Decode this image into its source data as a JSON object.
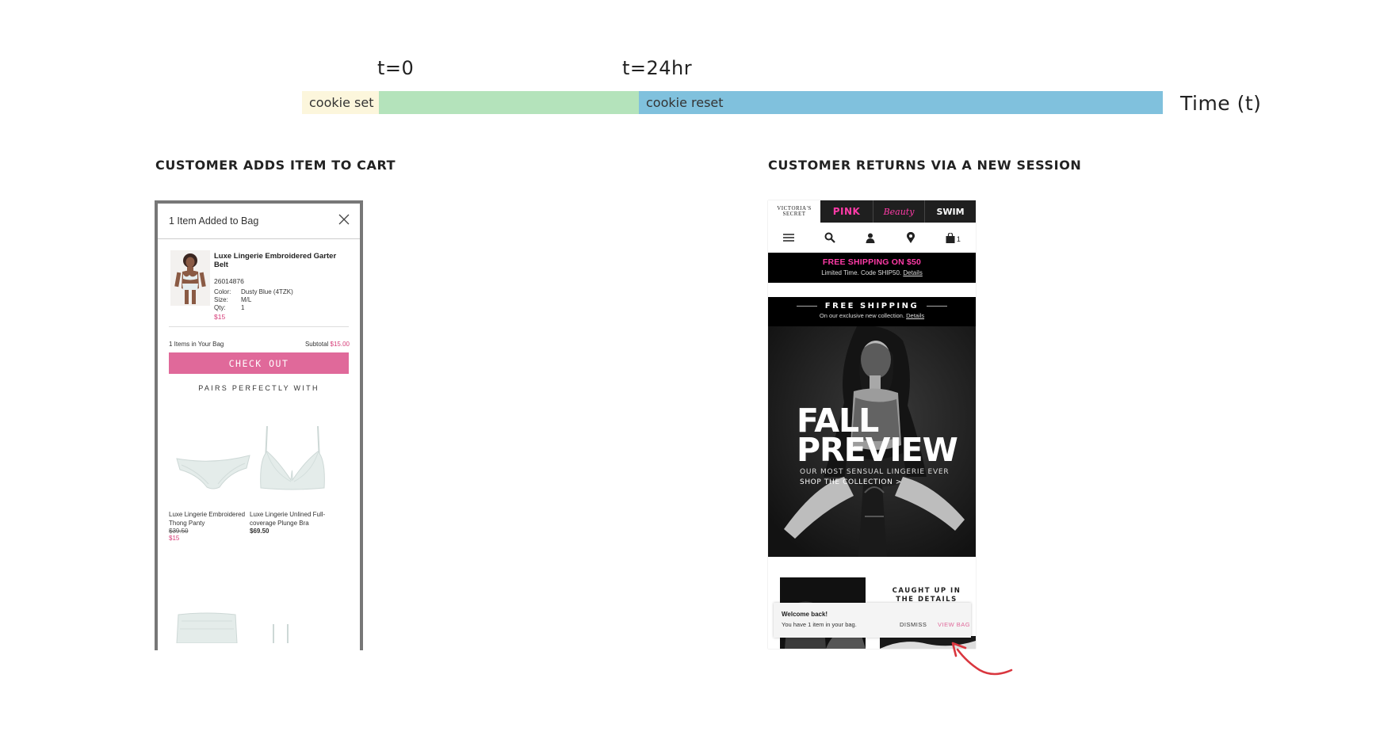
{
  "timeline": {
    "t0_label": "t=0",
    "t24_label": "t=24hr",
    "segment_set": "cookie set",
    "segment_reset": "cookie reset",
    "axis_title": "Time (t)",
    "colors": {
      "set": "#fcf6dc",
      "active": "#b4e3bb",
      "reset": "#80c1dd"
    }
  },
  "left_section": {
    "heading": "CUSTOMER ADDS ITEM TO CART",
    "modal_title": "1 Item Added to Bag",
    "item": {
      "name": "Luxe Lingerie Embroidered Garter Belt",
      "sku": "26014876",
      "color_key": "Color:",
      "color_value": "Dusty Blue (4TZK)",
      "size_key": "Size:",
      "size_value": "M/L",
      "qty_key": "Qty:",
      "qty_value": "1",
      "price": "$15"
    },
    "bag_count_text": "1 Items in Your Bag",
    "subtotal_label": "Subtotal",
    "subtotal_value": "$15.00",
    "checkout_label": "CHECK OUT",
    "pairs_heading": "PAIRS PERFECTLY WITH",
    "products": [
      {
        "name": "Luxe Lingerie Embroidered Thong Panty",
        "old_price": "$39.50",
        "price": "$15"
      },
      {
        "name": "Luxe Lingerie Unlined Full-coverage Plunge Bra",
        "price": "$69.50"
      }
    ]
  },
  "right_section": {
    "heading": "CUSTOMER RETURNS VIA A NEW SESSION",
    "brands": [
      "VICTORIA'S",
      "SECRET",
      "PINK",
      "Beauty",
      "SWIM"
    ],
    "bag_count": "1",
    "promo_title": "FREE SHIPPING ON $50",
    "promo_sub": "Limited Time. Code SHIP50.",
    "promo_link": "Details",
    "hero_band_title": "FREE SHIPPING",
    "hero_band_sub": "On our exclusive new collection.",
    "hero_band_link": "Details",
    "hero_line1": "FALL",
    "hero_line2": "PREVIEW",
    "hero_tagline": "OUR MOST SENSUAL LINGERIE EVER",
    "hero_cta": "SHOP THE COLLECTION >",
    "caught_line1": "CAUGHT UP IN",
    "caught_line2": "THE DETAILS",
    "toast_title": "Welcome back!",
    "toast_body": "You have 1 item in your bag.",
    "toast_dismiss": "DISMISS",
    "toast_view": "VIEW BAG",
    "accent_pink": "#e0699a",
    "arrow_color": "#d9363e"
  }
}
